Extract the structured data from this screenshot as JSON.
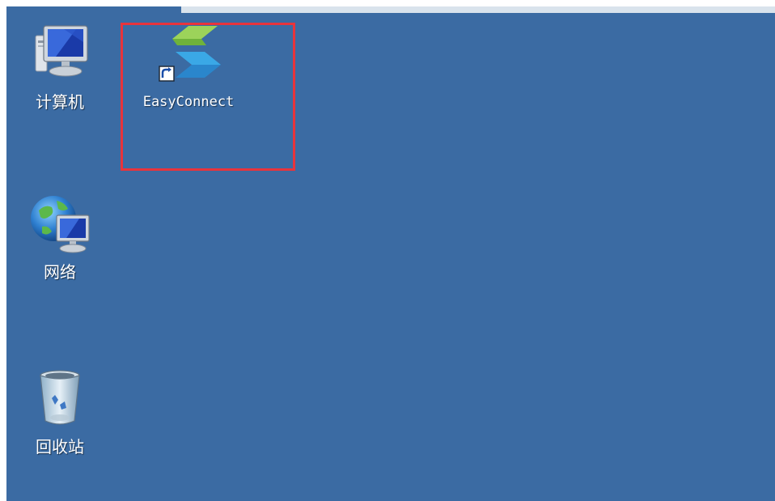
{
  "desktop": {
    "background_color": "#3b6ba3",
    "icons": [
      {
        "id": "computer",
        "label": "计算机",
        "icon": "computer-icon"
      },
      {
        "id": "easyconnect",
        "label": "EasyConnect",
        "icon": "easyconnect-shortcut-icon"
      },
      {
        "id": "network",
        "label": "网络",
        "icon": "network-icon"
      },
      {
        "id": "recycle",
        "label": "回收站",
        "icon": "recycle-bin-icon"
      }
    ]
  },
  "annotation": {
    "highlight_color": "#e8343c",
    "highlight_target": "easyconnect"
  }
}
